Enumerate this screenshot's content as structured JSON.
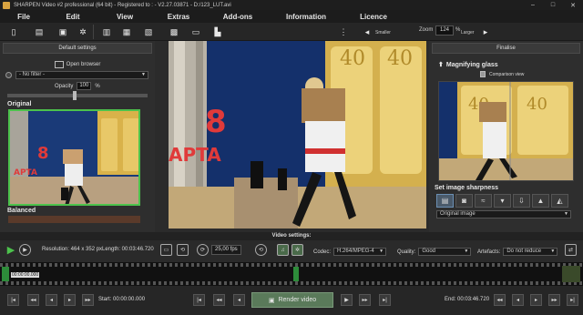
{
  "window": {
    "title": "SHARPEN Video #2 professional (64 bit) - Registered to : - V2.27.03871 - D:/123_LUT.avi",
    "controls": [
      "–",
      "□",
      "✕"
    ]
  },
  "menu": [
    "File",
    "Edit",
    "View",
    "Extras",
    "Add-ons",
    "Information",
    "Licence"
  ],
  "toolbar": {
    "icons": [
      "new-icon",
      "open-icon",
      "save-icon",
      "settings-icon",
      "film-icon",
      "compare-icon",
      "screenshot-icon",
      "clip-icon",
      "histogram-icon"
    ],
    "smaller_label": "Smaller",
    "zoom_label": "Zoom",
    "zoom_value": "124",
    "zoom_unit": "%",
    "larger_label": "Larger"
  },
  "left": {
    "header": "Default settings",
    "open_browser": "Open browser",
    "filter_value": "- No filter -",
    "opacity_label": "Opacity",
    "opacity_value": "100",
    "opacity_unit": "%",
    "section_original": "Original",
    "section_balanced": "Balanced"
  },
  "viewer": {
    "building_numbers": [
      "40",
      "40"
    ],
    "sign_text": "APTA",
    "sign_digit": "8"
  },
  "right": {
    "header": "Finalise",
    "magnifying_glass": "Magnifying glass",
    "comparison_view": "Comparison view",
    "thumb_numbers": [
      "40",
      "40"
    ],
    "sharpness_title": "Set image sharpness",
    "sharpness_select": "Original image"
  },
  "video_settings": {
    "header": "Video settings",
    "resolution": "Resolution: 464 x 352 px",
    "length": "Length: 00:03:46.720",
    "fps": "25,00 fps",
    "codec_label": "Codec:",
    "codec_value": "H.264/MPEG-4",
    "quality_label": "Quality:",
    "quality_value": "Good",
    "artefacts_label": "Artefacts:",
    "artefacts_value": "Do not reduce"
  },
  "timeline": {
    "time_display": "00:00:00.000"
  },
  "bottom": {
    "start_label": "Start: 00:00:00.000",
    "render_label": "Render video",
    "end_label": "End: 00:03:46.720"
  },
  "colors": {
    "accent_green": "#4cc24c",
    "background": "#2b2b2b",
    "panel": "#2e2e2e"
  }
}
